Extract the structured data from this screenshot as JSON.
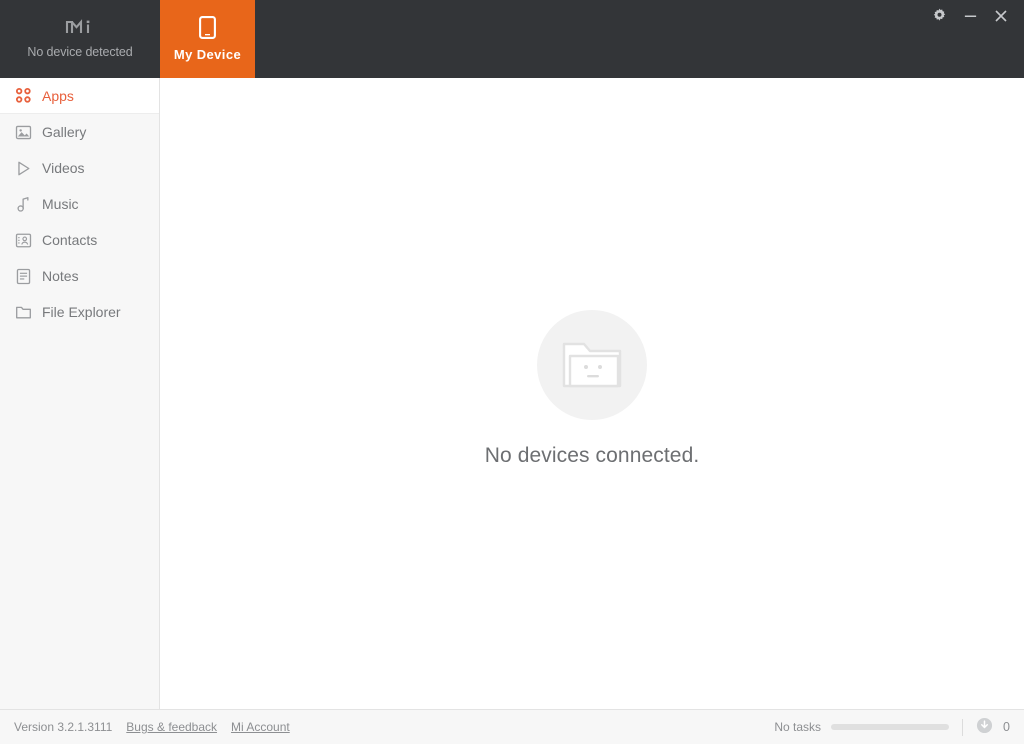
{
  "app": {
    "brand_logo": "mi-logo",
    "device_status": "No device detected",
    "device_tab_label": "My Device",
    "device_tab_icon": "phone-icon"
  },
  "window_controls": [
    {
      "name": "settings",
      "icon": "gear-icon"
    },
    {
      "name": "minimize",
      "icon": "minimize-icon"
    },
    {
      "name": "close",
      "icon": "close-icon"
    }
  ],
  "sidebar": {
    "items": [
      {
        "label": "Apps",
        "icon": "apps-grid-icon",
        "active": true
      },
      {
        "label": "Gallery",
        "icon": "image-icon",
        "active": false
      },
      {
        "label": "Videos",
        "icon": "play-triangle-icon",
        "active": false
      },
      {
        "label": "Music",
        "icon": "music-note-icon",
        "active": false
      },
      {
        "label": "Contacts",
        "icon": "contact-card-icon",
        "active": false
      },
      {
        "label": "Notes",
        "icon": "note-lines-icon",
        "active": false
      },
      {
        "label": "File Explorer",
        "icon": "folder-icon",
        "active": false
      }
    ]
  },
  "main": {
    "empty_state_icon": "sad-folder-icon",
    "empty_state_text": "No devices connected."
  },
  "statusbar": {
    "version": "Version 3.2.1.3111",
    "bugs_link": "Bugs & feedback",
    "account_link": "Mi Account",
    "tasks_label": "No tasks",
    "download_icon": "download-circle-icon",
    "download_count": "0"
  },
  "colors": {
    "titlebar_bg": "#333538",
    "accent_orange": "#e8661a",
    "active_item": "#e8603c",
    "sidebar_bg": "#f7f7f7",
    "main_bg": "#ffffff",
    "muted_text": "#8d8f92"
  }
}
